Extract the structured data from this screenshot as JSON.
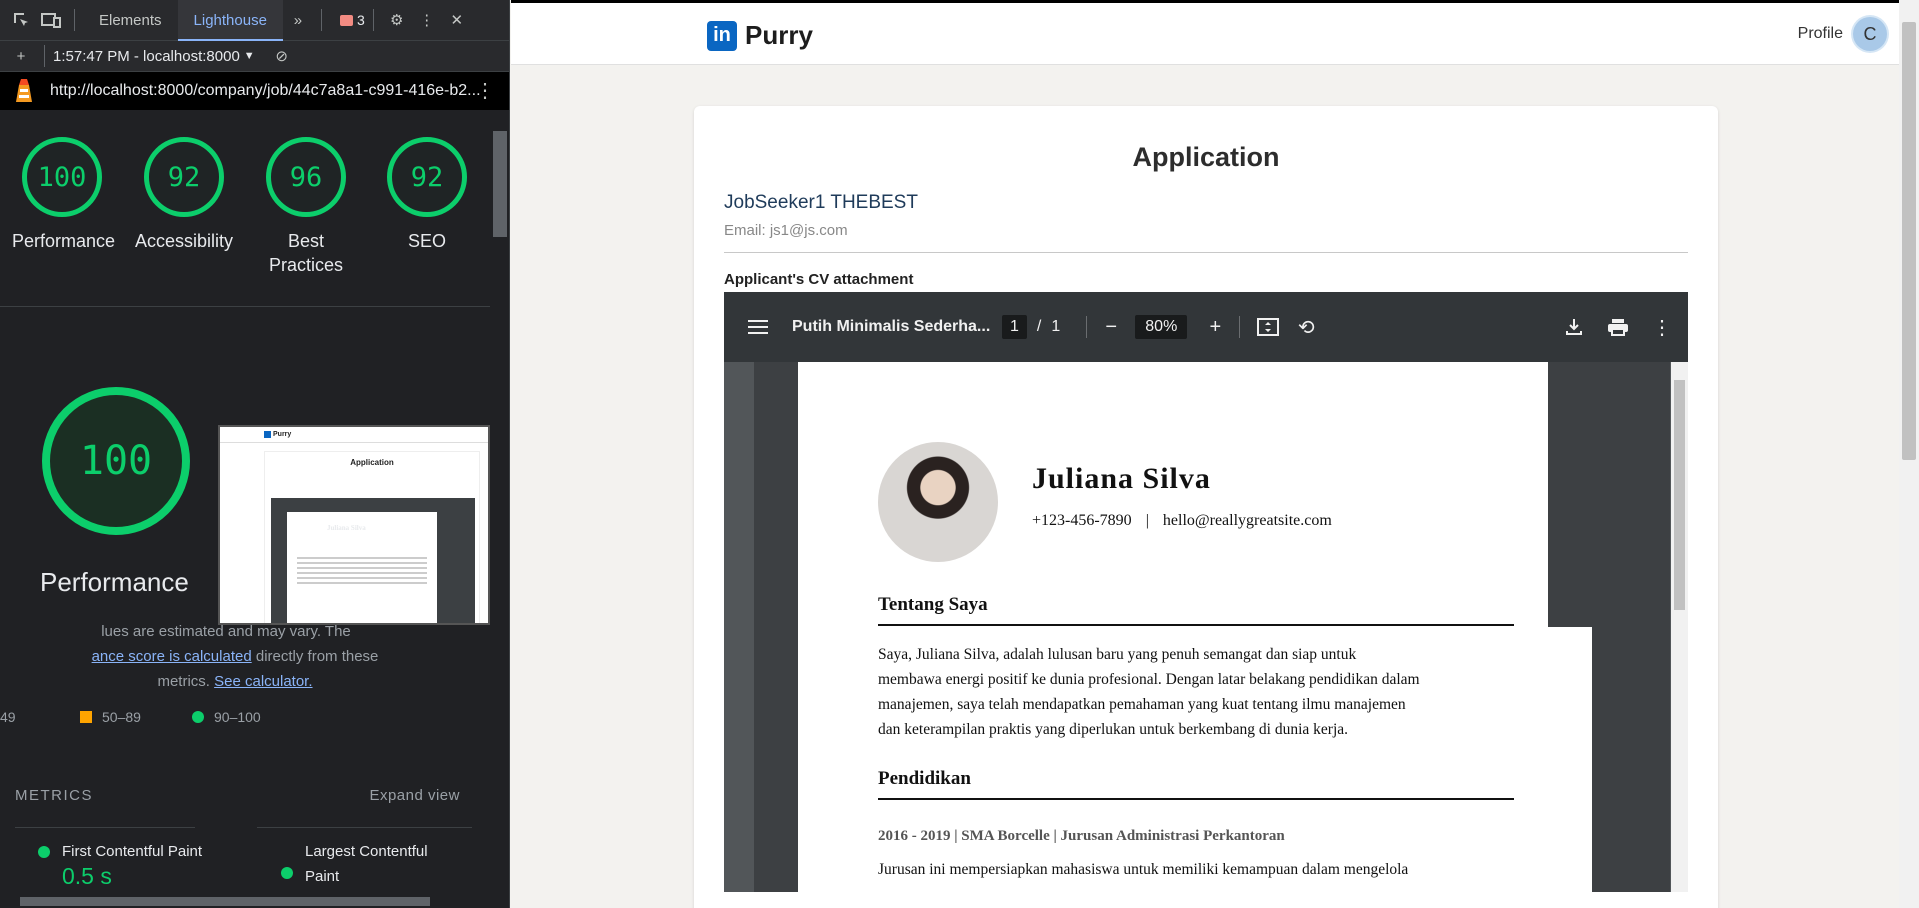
{
  "devtools": {
    "tabs": [
      "Elements",
      "Lighthouse"
    ],
    "issues_count": "3",
    "report_time": "1:57:47 PM - localhost:8000",
    "url": "http://localhost:8000/company/job/44c7a8a1-c991-416e-b2...",
    "scores": [
      {
        "value": "100",
        "label": "Performance"
      },
      {
        "value": "92",
        "label": "Accessibility"
      },
      {
        "value": "96",
        "label": "Best Practices"
      },
      {
        "value": "92",
        "label": "SEO"
      }
    ],
    "big_score": "100",
    "big_label": "Performance",
    "note_line1": "lues are estimated and may vary. The",
    "note_link1": "ance score is calculated",
    "note_line2_rest": " directly from these",
    "note_line3": "metrics. ",
    "note_link2": "See calculator.",
    "legend": {
      "low": "49",
      "mid": "50–89",
      "high": "90–100"
    },
    "metrics_title": "METRICS",
    "expand_view": "Expand view",
    "metrics": [
      {
        "name": "First Contentful Paint",
        "value": "0.5 s"
      },
      {
        "name": "Largest Contentful Paint",
        "value": ""
      }
    ],
    "thumb": {
      "brand": "Purry",
      "title": "Application",
      "cv_name": "Juliana Silva"
    }
  },
  "site": {
    "brand_logo": "in",
    "brand": "Purry",
    "profile_label": "Profile",
    "avatar_letter": "C"
  },
  "application": {
    "title": "Application",
    "applicant_name": "JobSeeker1 THEBEST",
    "email": "Email: js1@js.com",
    "cv_label": "Applicant's CV attachment"
  },
  "pdf_viewer": {
    "file_name": "Putih Minimalis Sederha...",
    "current_page": "1",
    "total_pages": "1",
    "zoom": "80%"
  },
  "cv": {
    "name": "Juliana Silva",
    "phone": "+123-456-7890",
    "email": "hello@reallygreatsite.com",
    "about_heading": "Tentang Saya",
    "about_lines": [
      "Saya, Juliana Silva, adalah lulusan baru yang penuh semangat dan siap untuk",
      "membawa energi positif ke dunia profesional. Dengan latar belakang pendidikan dalam",
      "manajemen, saya telah mendapatkan pemahaman yang kuat tentang ilmu manajemen",
      "dan keterampilan praktis yang diperlukan untuk berkembang di dunia kerja."
    ],
    "education_heading": "Pendidikan",
    "edu_entry": "2016 - 2019 | SMA Borcelle | Jurusan Administrasi Perkantoran",
    "edu_desc": "Jurusan ini mempersiapkan mahasiswa untuk memiliki kemampuan dalam mengelola"
  }
}
